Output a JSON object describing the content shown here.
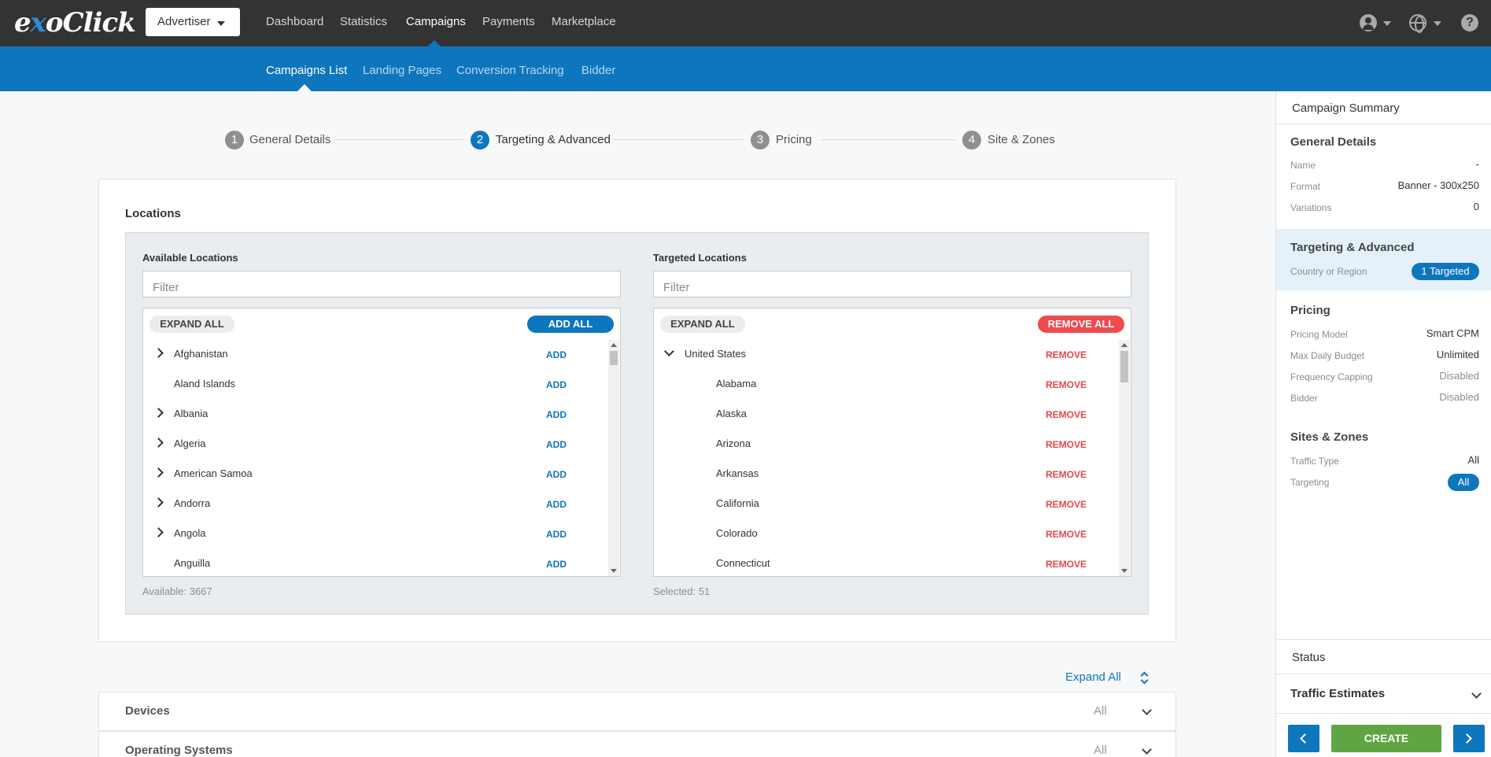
{
  "topbar": {
    "logo": {
      "pre": "e",
      "x": "x",
      "post": "oClick"
    },
    "account_dropdown": "Advertiser",
    "nav": [
      "Dashboard",
      "Statistics",
      "Campaigns",
      "Payments",
      "Marketplace"
    ],
    "active_nav": "Campaigns",
    "icons": [
      "user-icon",
      "globe-icon",
      "help-icon"
    ]
  },
  "subnav": {
    "items": [
      "Campaigns List",
      "Landing Pages",
      "Conversion Tracking",
      "Bidder"
    ],
    "active": "Campaigns List"
  },
  "stepper": [
    {
      "num": "1",
      "label": "General Details"
    },
    {
      "num": "2",
      "label": "Targeting & Advanced"
    },
    {
      "num": "3",
      "label": "Pricing"
    },
    {
      "num": "4",
      "label": "Site & Zones"
    }
  ],
  "locations": {
    "title": "Locations",
    "available": {
      "title": "Available Locations",
      "filter_placeholder": "Filter",
      "expand_all": "EXPAND ALL",
      "add_all": "ADD ALL",
      "items": [
        {
          "name": "Afghanistan",
          "expandable": true,
          "action": "ADD"
        },
        {
          "name": "Aland Islands",
          "expandable": false,
          "action": "ADD"
        },
        {
          "name": "Albania",
          "expandable": true,
          "action": "ADD"
        },
        {
          "name": "Algeria",
          "expandable": true,
          "action": "ADD"
        },
        {
          "name": "American Samoa",
          "expandable": true,
          "action": "ADD"
        },
        {
          "name": "Andorra",
          "expandable": true,
          "action": "ADD"
        },
        {
          "name": "Angola",
          "expandable": true,
          "action": "ADD"
        },
        {
          "name": "Anguilla",
          "expandable": false,
          "action": "ADD"
        }
      ],
      "count": "Available: 3667"
    },
    "targeted": {
      "title": "Targeted Locations",
      "filter_placeholder": "Filter",
      "expand_all": "EXPAND ALL",
      "remove_all": "REMOVE ALL",
      "items": [
        {
          "name": "United States",
          "level": 0,
          "expanded": true,
          "action": "REMOVE"
        },
        {
          "name": "Alabama",
          "level": 1,
          "action": "REMOVE"
        },
        {
          "name": "Alaska",
          "level": 1,
          "action": "REMOVE"
        },
        {
          "name": "Arizona",
          "level": 1,
          "action": "REMOVE"
        },
        {
          "name": "Arkansas",
          "level": 1,
          "action": "REMOVE"
        },
        {
          "name": "California",
          "level": 1,
          "action": "REMOVE"
        },
        {
          "name": "Colorado",
          "level": 1,
          "action": "REMOVE"
        },
        {
          "name": "Connecticut",
          "level": 1,
          "action": "REMOVE"
        }
      ],
      "count": "Selected: 51"
    }
  },
  "expand_all_link": "Expand All",
  "accordions": [
    {
      "title": "Devices",
      "value": "All"
    },
    {
      "title": "Operating Systems",
      "value": "All"
    }
  ],
  "summary": {
    "title": "Campaign Summary",
    "general": {
      "title": "General Details",
      "rows": [
        {
          "label": "Name",
          "value": "-"
        },
        {
          "label": "Format",
          "value": "Banner - 300x250"
        },
        {
          "label": "Variations",
          "value": "0"
        }
      ]
    },
    "targeting": {
      "title": "Targeting & Advanced",
      "label": "Country or Region",
      "badge": "1 Targeted"
    },
    "pricing": {
      "title": "Pricing",
      "rows": [
        {
          "label": "Pricing Model",
          "value": "Smart CPM"
        },
        {
          "label": "Max Daily Budget",
          "value": "Unlimited"
        },
        {
          "label": "Frequency Capping",
          "value": "Disabled"
        },
        {
          "label": "Bidder",
          "value": "Disabled"
        }
      ]
    },
    "sites": {
      "title": "Sites & Zones",
      "traffic_type_label": "Traffic Type",
      "traffic_type_value": "All",
      "targeting_label": "Targeting",
      "targeting_badge": "All"
    },
    "status": "Status",
    "traffic_estimates": "Traffic Estimates",
    "create": "CREATE"
  },
  "colors": {
    "primary": "#0e76bd",
    "danger": "#ef4b4f",
    "success": "#5fa544",
    "topbar": "#333333"
  }
}
